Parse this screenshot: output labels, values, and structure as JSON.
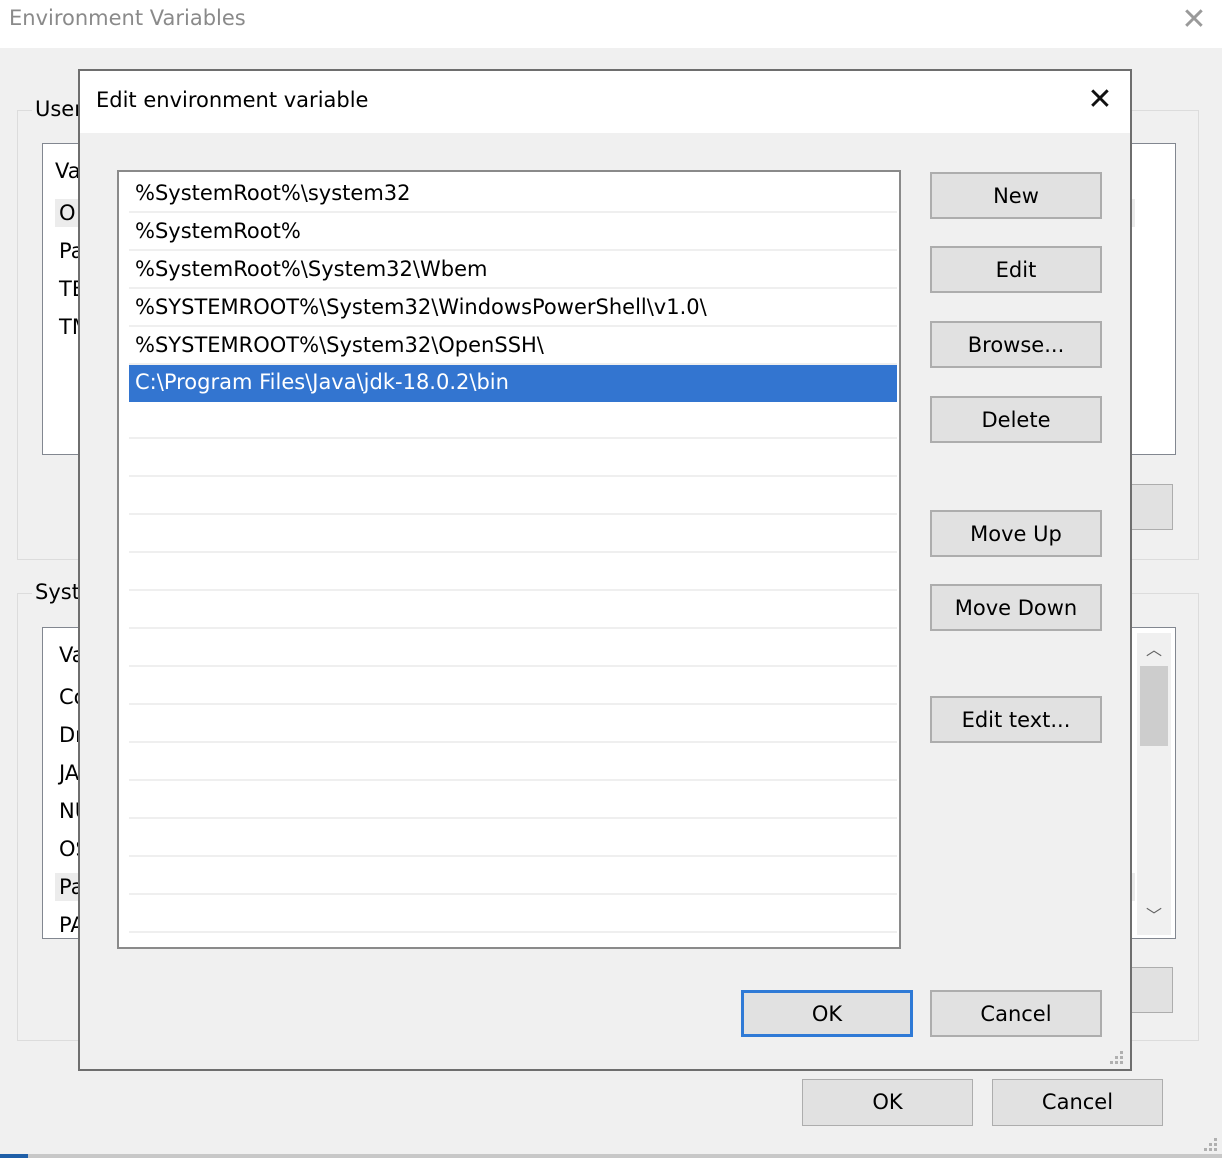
{
  "outer_window": {
    "title": "Environment Variables",
    "close_icon": "close-icon",
    "user_group": {
      "label": "User",
      "header": "Va",
      "rows": [
        "O",
        "Pa",
        "TE",
        "TM"
      ]
    },
    "system_group": {
      "label": "Syst",
      "header": "Va",
      "rows": [
        "Co",
        "Dr",
        "JA",
        "NU",
        "OS",
        "Pa",
        "PA"
      ]
    },
    "ok_label": "OK",
    "cancel_label": "Cancel"
  },
  "dialog": {
    "title": "Edit environment variable",
    "close_icon": "close-icon",
    "paths": [
      "%SystemRoot%\\system32",
      "%SystemRoot%",
      "%SystemRoot%\\System32\\Wbem",
      "%SYSTEMROOT%\\System32\\WindowsPowerShell\\v1.0\\",
      "%SYSTEMROOT%\\System32\\OpenSSH\\",
      "C:\\Program Files\\Java\\jdk-18.0.2\\bin"
    ],
    "selected_index": 5,
    "buttons": {
      "new": "New",
      "edit": "Edit",
      "browse": "Browse...",
      "delete": "Delete",
      "move_up": "Move Up",
      "move_down": "Move Down",
      "edit_text": "Edit text..."
    },
    "ok_label": "OK",
    "cancel_label": "Cancel"
  },
  "colors": {
    "selection": "#3375d0",
    "default_button_border": "#2f7ad6"
  }
}
